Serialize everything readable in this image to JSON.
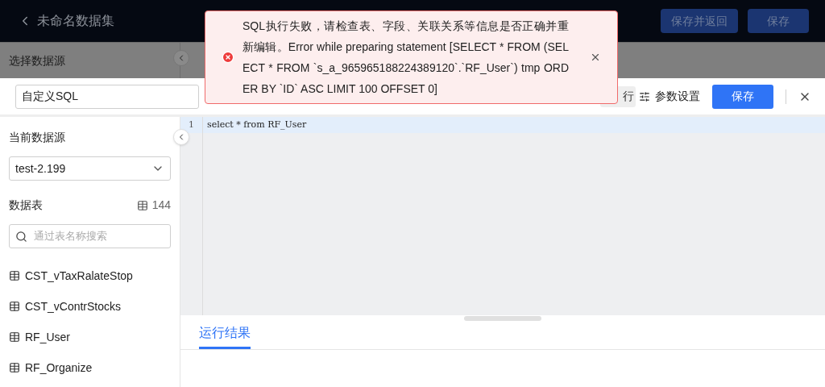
{
  "header": {
    "title": "未命名数据集",
    "buttons": [
      "保存并返回",
      "保存"
    ]
  },
  "background_panel": {
    "title": "选择数据源"
  },
  "dialog": {
    "name_field": {
      "value": "自定义SQL"
    },
    "run_button": "行",
    "params_button": "参数设置",
    "save_button": "保存",
    "source_label": "当前数据源",
    "source_select": {
      "value": "test-2.199"
    },
    "tables_label": "数据表",
    "tables_count": "144",
    "search": {
      "placeholder": "通过表名称搜索"
    },
    "tables": [
      {
        "name": "CST_vTaxRalateStop"
      },
      {
        "name": "CST_vContrStocks"
      },
      {
        "name": "RF_User"
      },
      {
        "name": "RF_Organize"
      }
    ],
    "editor": {
      "lines": [
        {
          "number": "1",
          "code": "select * from RF_User"
        }
      ]
    },
    "result_tabs": [
      {
        "label": "运行结果",
        "selected": true
      }
    ]
  },
  "toast": {
    "kind": "error",
    "message": "SQL执行失败，请检查表、字段、关联关系等信息是否正确并重新编辑。Error while preparing statement [SELECT * FROM (SELECT * FROM `s_a_965965188224389120`.`RF_User`) tmp ORDER BY `ID` ASC LIMIT 100 OFFSET 0]"
  }
}
